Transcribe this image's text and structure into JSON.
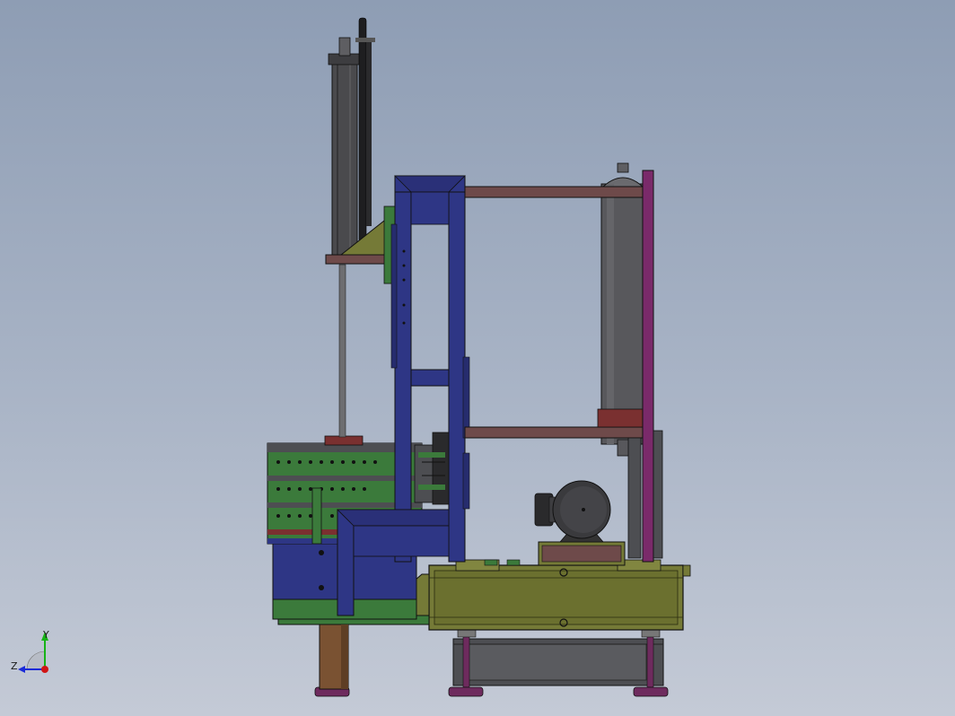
{
  "view": {
    "background_top": "#8e9db4",
    "background_bottom": "#c4cad6"
  },
  "triad": {
    "y_label": "Y",
    "z_label": "Z",
    "x_color": "#d01515",
    "y_color": "#17b317",
    "z_color": "#1a2ad8"
  },
  "colors": {
    "frame": "#2e3685",
    "base": "#757a37",
    "cylinder": "#4a4a4d",
    "tank": "#58585c",
    "magenta": "#7a2a6a",
    "green": "#3b7a3b",
    "rod": "#6d6d70",
    "copper": "#7a5232"
  }
}
